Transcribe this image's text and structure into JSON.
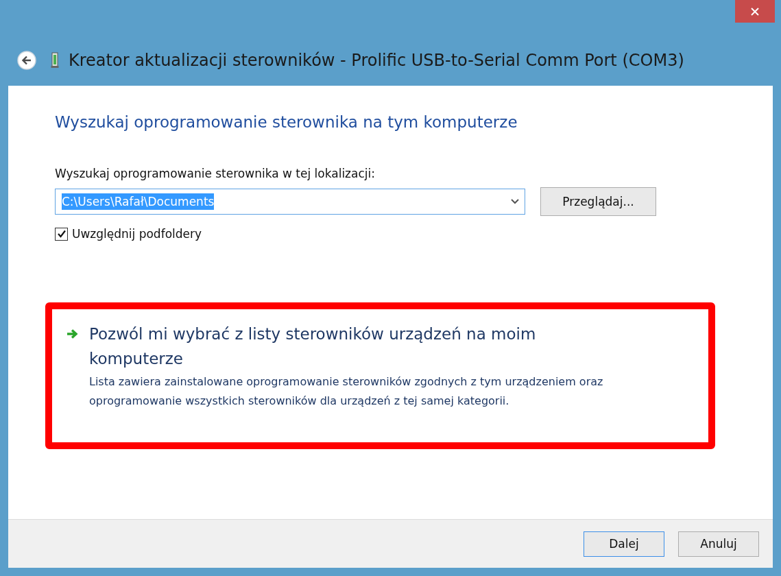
{
  "window": {
    "title": "Kreator aktualizacji sterowników - Prolific USB-to-Serial Comm Port (COM3)"
  },
  "heading": "Wyszukaj oprogramowanie sterownika na tym komputerze",
  "location": {
    "label": "Wyszukaj oprogramowanie sterownika w tej lokalizacji:",
    "value": "C:\\Users\\Rafał\\Documents",
    "selected": true,
    "browse_button": "Przeglądaj..."
  },
  "include_subfolders": {
    "label": "Uwzględnij podfoldery",
    "checked": true
  },
  "option": {
    "title": "Pozwól mi wybrać z listy sterowników urządzeń na moim komputerze",
    "description": "Lista zawiera zainstalowane oprogramowanie sterowników zgodnych z tym urządzeniem oraz oprogramowanie wszystkich sterowników dla urządzeń z tej samej kategorii.",
    "highlighted": true
  },
  "buttons": [
    {
      "label": "Dalej",
      "default": true
    },
    {
      "label": "Anuluj",
      "default": false
    }
  ]
}
